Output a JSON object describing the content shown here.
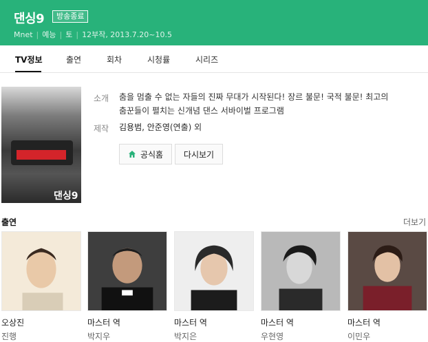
{
  "header": {
    "title": "댄싱9",
    "status_badge": "방송종료",
    "channel": "Mnet",
    "genre": "예능",
    "day": "토",
    "episodes_dates": "12부작, 2013.7.20~10.5"
  },
  "tabs": [
    {
      "label": "TV정보",
      "active": true
    },
    {
      "label": "출연"
    },
    {
      "label": "회차"
    },
    {
      "label": "시청률"
    },
    {
      "label": "시리즈"
    }
  ],
  "info": {
    "summary_label": "소개",
    "summary_line1": "춤을 멈출 수 없는 자들의 진짜 무대가 시작된다! 장르 불문! 국적 불문! 최고의",
    "summary_line2": "춤꾼들이 펼치는 신개념 댄스 서바이벌 프로그램",
    "production_label": "제작",
    "producers": "김용범, 안준영",
    "producers_role": "(연출) 외",
    "official_home_button": "공식홈",
    "replay_button": "다시보기"
  },
  "cast_section": {
    "title": "출연",
    "more_link": "더보기",
    "members": [
      {
        "role": "오상진",
        "sub": "진행"
      },
      {
        "role": "마스터 역",
        "sub": "박지우"
      },
      {
        "role": "마스터 역",
        "sub": "박지은"
      },
      {
        "role": "마스터 역",
        "sub": "우현영"
      },
      {
        "role": "마스터 역",
        "sub": "이민우"
      }
    ]
  },
  "colors": {
    "brand_green": "#28b27a",
    "home_icon_green": "#28b27a"
  },
  "icons": {
    "home": "home-icon"
  }
}
